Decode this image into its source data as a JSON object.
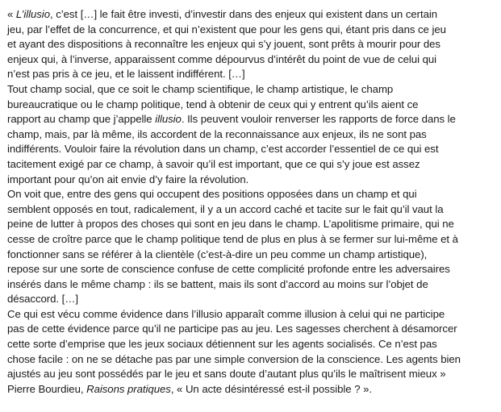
{
  "document": {
    "lines": [
      [
        {
          "t": "« "
        },
        {
          "t": "L’illusio",
          "i": true
        },
        {
          "t": ", c’est […] le fait être investi, d’investir dans des enjeux qui existent dans un certain"
        }
      ],
      [
        {
          "t": "jeu, par l’effet de la concurrence, et qui n’existent que pour les gens qui, étant pris dans ce jeu"
        }
      ],
      [
        {
          "t": "et ayant des dispositions à reconnaître les enjeux qui s’y jouent, sont prêts à mourir pour des"
        }
      ],
      [
        {
          "t": "enjeux qui, à l’inverse, apparaissent comme dépourvus d’intérêt du point de vue de celui qui"
        }
      ],
      [
        {
          "t": "n’est pas pris à ce jeu, et le laissent indifférent. […]"
        }
      ],
      [
        {
          "t": "Tout champ social, que ce soit le champ scientifique, le champ artistique, le champ"
        }
      ],
      [
        {
          "t": "bureaucratique ou le champ politique, tend à obtenir de ceux qui y entrent qu’ils aient ce"
        }
      ],
      [
        {
          "t": "rapport au champ que j’appelle "
        },
        {
          "t": "illusio",
          "i": true
        },
        {
          "t": ". Ils peuvent vouloir renverser les rapports de force dans le"
        }
      ],
      [
        {
          "t": "champ, mais, par là même, ils accordent de la reconnaissance aux enjeux, ils ne sont pas"
        }
      ],
      [
        {
          "t": "indifférents. Vouloir faire la révolution dans un champ, c’est accorder l’essentiel de ce qui est"
        }
      ],
      [
        {
          "t": "tacitement exigé par ce champ, à savoir qu’il est important, que ce qui s’y joue est assez"
        }
      ],
      [
        {
          "t": "important pour qu’on ait envie d’y faire la révolution."
        }
      ],
      [
        {
          "t": "On voit que, entre des gens qui occupent des positions opposées dans un champ et qui"
        }
      ],
      [
        {
          "t": "semblent opposés en tout, radicalement, il y a un accord caché et tacite sur le fait qu’il vaut la"
        }
      ],
      [
        {
          "t": "peine de lutter à propos des choses qui sont en jeu dans le champ. L’apolitisme primaire, qui ne"
        }
      ],
      [
        {
          "t": "cesse de croître parce que le champ politique tend de plus en plus à se fermer sur lui-même et à"
        }
      ],
      [
        {
          "t": "fonctionner sans se référer à la clientèle (c’est-à-dire un peu comme un champ artistique),"
        }
      ],
      [
        {
          "t": "repose sur une sorte de conscience confuse de cette complicité profonde entre les adversaires"
        }
      ],
      [
        {
          "t": "insérés dans le même champ : ils se battent, mais ils sont d’accord au moins sur l’objet de"
        }
      ],
      [
        {
          "t": "désaccord. […]"
        }
      ],
      [
        {
          "t": "Ce qui est vécu comme évidence dans l’illusio apparaît comme illusion à celui qui ne participe"
        }
      ],
      [
        {
          "t": "pas de cette évidence parce qu’il ne participe pas au jeu. Les sagesses cherchent à désamorcer"
        }
      ],
      [
        {
          "t": "cette sorte d’emprise que les jeux sociaux détiennent sur les agents socialisés. Ce n’est pas"
        }
      ],
      [
        {
          "t": "chose facile : on ne se détache pas par une simple conversion de la conscience. Les agents bien"
        }
      ],
      [
        {
          "t": "ajustés au jeu sont possédés par le jeu et sans doute d’autant plus qu’ils le maîtrisent mieux »"
        }
      ],
      [
        {
          "t": "Pierre Bourdieu, "
        },
        {
          "t": "Raisons pratiques",
          "i": true
        },
        {
          "t": ", « Un acte désintéressé est-il possible ? »."
        }
      ]
    ]
  }
}
